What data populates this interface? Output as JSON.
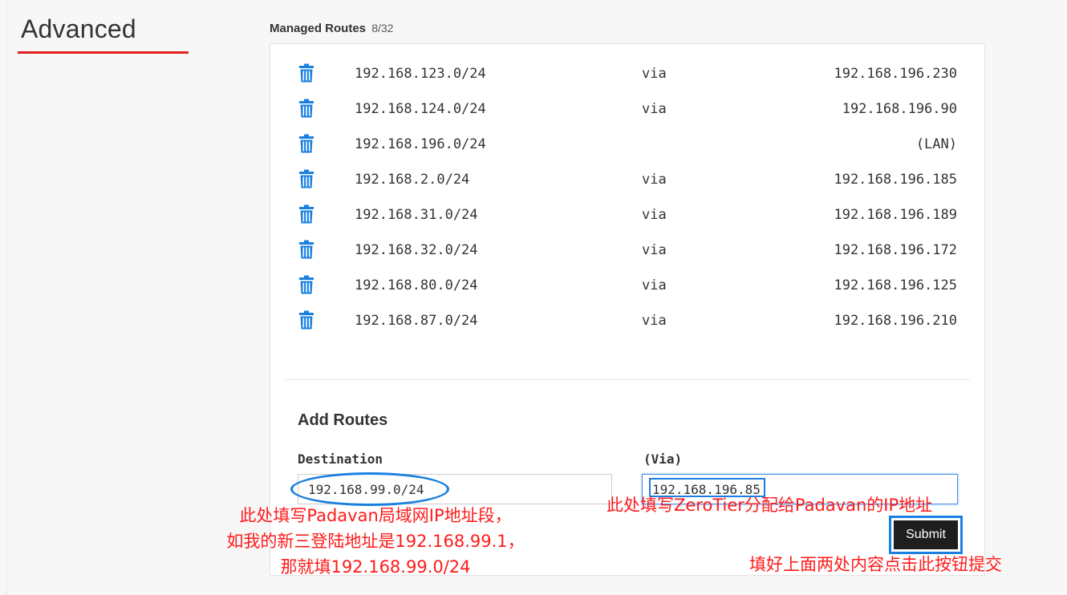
{
  "sidebar": {
    "title": "Advanced"
  },
  "managed_routes": {
    "label": "Managed Routes",
    "count": "8/32",
    "routes": [
      {
        "destination": "192.168.123.0/24",
        "via": "via",
        "gateway": "192.168.196.230"
      },
      {
        "destination": "192.168.124.0/24",
        "via": "via",
        "gateway": "192.168.196.90"
      },
      {
        "destination": "192.168.196.0/24",
        "via": "",
        "gateway": "(LAN)"
      },
      {
        "destination": "192.168.2.0/24",
        "via": "via",
        "gateway": "192.168.196.185"
      },
      {
        "destination": "192.168.31.0/24",
        "via": "via",
        "gateway": "192.168.196.189"
      },
      {
        "destination": "192.168.32.0/24",
        "via": "via",
        "gateway": "192.168.196.172"
      },
      {
        "destination": "192.168.80.0/24",
        "via": "via",
        "gateway": "192.168.196.125"
      },
      {
        "destination": "192.168.87.0/24",
        "via": "via",
        "gateway": "192.168.196.210"
      }
    ]
  },
  "add_routes": {
    "title": "Add Routes",
    "destination_label": "Destination",
    "destination_value": "192.168.99.0/24",
    "via_label": "(Via)",
    "via_value": "192.168.196.85",
    "submit_label": "Submit"
  },
  "annotations": {
    "left_line1": "此处填写Padavan局域网IP地址段，",
    "left_line2": "如我的新三登陆地址是192.168.99.1，",
    "left_line3": "那就填192.168.99.0/24",
    "right": "此处填写ZeroTier分配给Padavan的IP地址",
    "submit": "填好上面两处内容点击此按钮提交"
  },
  "colors": {
    "accent_red": "#e02020",
    "trash_blue": "#1a7fe0",
    "annotation_red": "#ff1a1a"
  },
  "icons": {
    "route_delete": "trash-icon"
  }
}
